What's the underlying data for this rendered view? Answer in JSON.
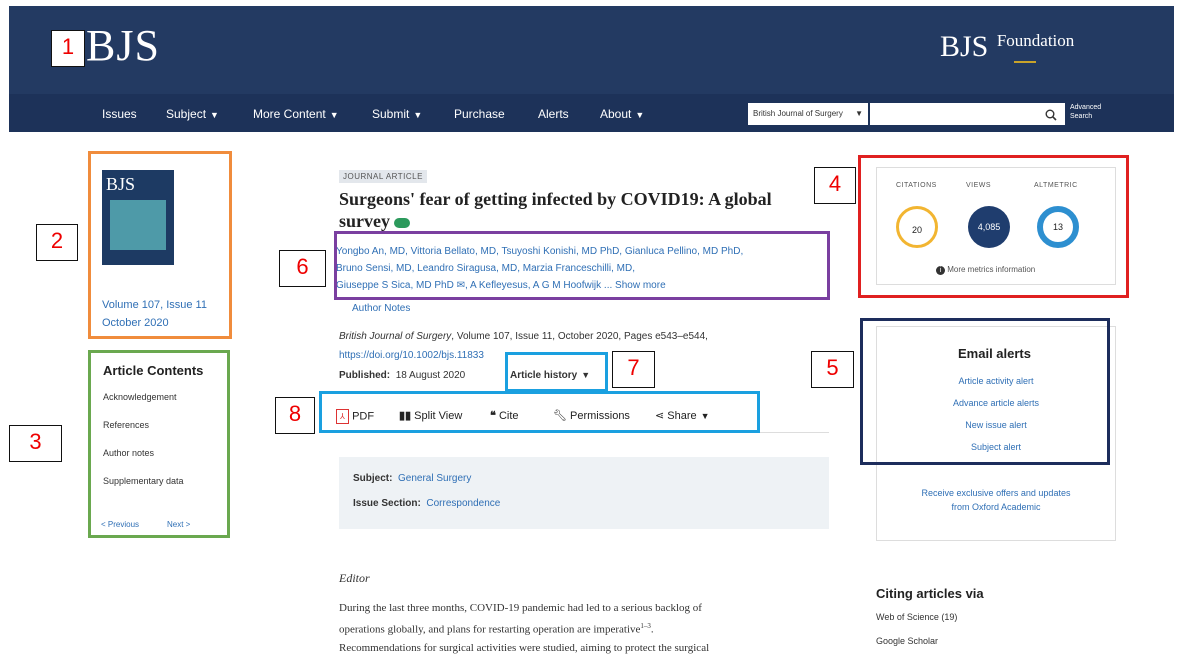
{
  "header": {
    "logo": "BJS",
    "foundation_logo": "BJS",
    "foundation_word": "Foundation",
    "nav": [
      {
        "label": "Issues"
      },
      {
        "label": "Subject"
      },
      {
        "label": "More Content"
      },
      {
        "label": "Submit"
      },
      {
        "label": "Purchase"
      },
      {
        "label": "Alerts"
      },
      {
        "label": "About"
      }
    ],
    "search_scope": "British Journal of Surgery",
    "search_placeholder": "",
    "advanced_search": "Advanced Search"
  },
  "cover": {
    "title": "BJS",
    "volume": "Volume 107, Issue 11",
    "date": "October 2020"
  },
  "toc": {
    "heading": "Article Contents",
    "items": [
      "Acknowledgement",
      "References",
      "Author notes",
      "Supplementary data"
    ],
    "prev": "< Previous",
    "next": "Next >"
  },
  "article": {
    "type_badge": "JOURNAL ARTICLE",
    "title": "Surgeons' fear of getting infected by COVID19: A global survey",
    "authors_lines": [
      "Yongbo An, MD, Vittoria Bellato, MD, Tsuyoshi Konishi, MD PhD, Gianluca Pellino, MD PhD,",
      "Bruno Sensi, MD, Leandro Siragusa, MD, Marzia Franceschilli, MD,",
      "Giuseppe S Sica, MD PhD ✉, A Kefleyesus, A G M Hoofwijk ... Show more"
    ],
    "author_notes": "Author Notes",
    "citation_journal": "British Journal of Surgery",
    "citation_rest": ", Volume 107, Issue 11, October 2020, Pages e543–e544,",
    "doi": "https://doi.org/10.1002/bjs.11833",
    "published_label": "Published:",
    "published_date": "18 August 2020",
    "history": "Article history",
    "tools": [
      {
        "label": "PDF",
        "icon": "pdf-icon"
      },
      {
        "label": "Split View",
        "icon": "split-view-icon"
      },
      {
        "label": "Cite",
        "icon": "quote-icon"
      },
      {
        "label": "Permissions",
        "icon": "wrench-icon"
      },
      {
        "label": "Share",
        "icon": "share-icon"
      }
    ],
    "subject_label": "Subject:",
    "subject_value": "General Surgery",
    "section_label": "Issue Section:",
    "section_value": "Correspondence",
    "body_heading": "Editor",
    "body_lines": [
      "During the last three months, COVID-19 pandemic had led to a serious backlog of",
      "operations globally, and plans for restarting operation are imperative",
      "Recommendations for surgical activities were studied, aiming to protect the surgical"
    ],
    "body_sup": "1–3"
  },
  "metrics": {
    "labels": [
      "CITATIONS",
      "VIEWS",
      "ALTMETRIC"
    ],
    "values": [
      "20",
      "4,085",
      "13"
    ],
    "more": "More metrics information"
  },
  "alerts": {
    "heading": "Email alerts",
    "items": [
      "Article activity alert",
      "Advance article alerts",
      "New issue alert",
      "Subject alert"
    ],
    "offers_line1": "Receive exclusive offers and updates",
    "offers_line2": "from Oxford Academic"
  },
  "citing": {
    "heading": "Citing articles via",
    "items": [
      "Web of Science (19)",
      "Google Scholar"
    ]
  },
  "annotations": [
    "1",
    "2",
    "3",
    "4",
    "5",
    "6",
    "7",
    "8"
  ],
  "colors": {
    "header_bg": "#233a62",
    "link": "#2f6fb5",
    "box1": "#f08c3c",
    "box3": "#6aa84f",
    "box4": "#e02020",
    "box5": "#1d2d5c",
    "box6": "#7a3fa0",
    "box7": "#1aa0e0"
  }
}
